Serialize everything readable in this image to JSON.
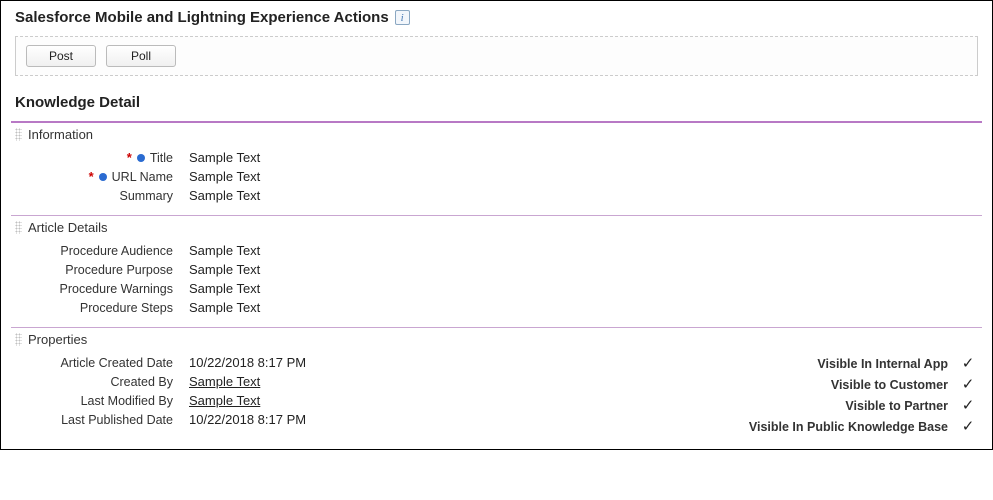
{
  "header": {
    "title": "Salesforce Mobile and Lightning Experience Actions",
    "actions": [
      {
        "name": "post-button",
        "label": "Post"
      },
      {
        "name": "poll-button",
        "label": "Poll"
      }
    ]
  },
  "detail_title": "Knowledge Detail",
  "sections": {
    "information": {
      "heading": "Information",
      "fields": [
        {
          "label": "Title",
          "value": "Sample Text",
          "required": true,
          "dot": true,
          "name": "field-title"
        },
        {
          "label": "URL Name",
          "value": "Sample Text",
          "required": true,
          "dot": true,
          "name": "field-url-name"
        },
        {
          "label": "Summary",
          "value": "Sample Text",
          "required": false,
          "dot": false,
          "name": "field-summary"
        }
      ]
    },
    "article_details": {
      "heading": "Article Details",
      "fields": [
        {
          "label": "Procedure Audience",
          "value": "Sample Text",
          "name": "field-procedure-audience"
        },
        {
          "label": "Procedure Purpose",
          "value": "Sample Text",
          "name": "field-procedure-purpose"
        },
        {
          "label": "Procedure Warnings",
          "value": "Sample Text",
          "name": "field-procedure-warnings"
        },
        {
          "label": "Procedure Steps",
          "value": "Sample Text",
          "name": "field-procedure-steps"
        }
      ]
    },
    "properties": {
      "heading": "Properties",
      "left": [
        {
          "label": "Article Created Date",
          "value": "10/22/2018 8:17 PM",
          "link": false,
          "name": "field-article-created-date"
        },
        {
          "label": "Created By",
          "value": "Sample Text",
          "link": true,
          "name": "field-created-by"
        },
        {
          "label": "Last Modified By",
          "value": "Sample Text",
          "link": true,
          "name": "field-last-modified-by"
        },
        {
          "label": "Last Published Date",
          "value": "10/22/2018 8:17 PM",
          "link": false,
          "name": "field-last-published-date"
        }
      ],
      "right": [
        {
          "label": "Visible In Internal App",
          "checked": true,
          "name": "visible-internal-app"
        },
        {
          "label": "Visible to Customer",
          "checked": true,
          "name": "visible-customer"
        },
        {
          "label": "Visible to Partner",
          "checked": true,
          "name": "visible-partner"
        },
        {
          "label": "Visible In Public Knowledge Base",
          "checked": true,
          "name": "visible-public-kb"
        }
      ]
    }
  }
}
